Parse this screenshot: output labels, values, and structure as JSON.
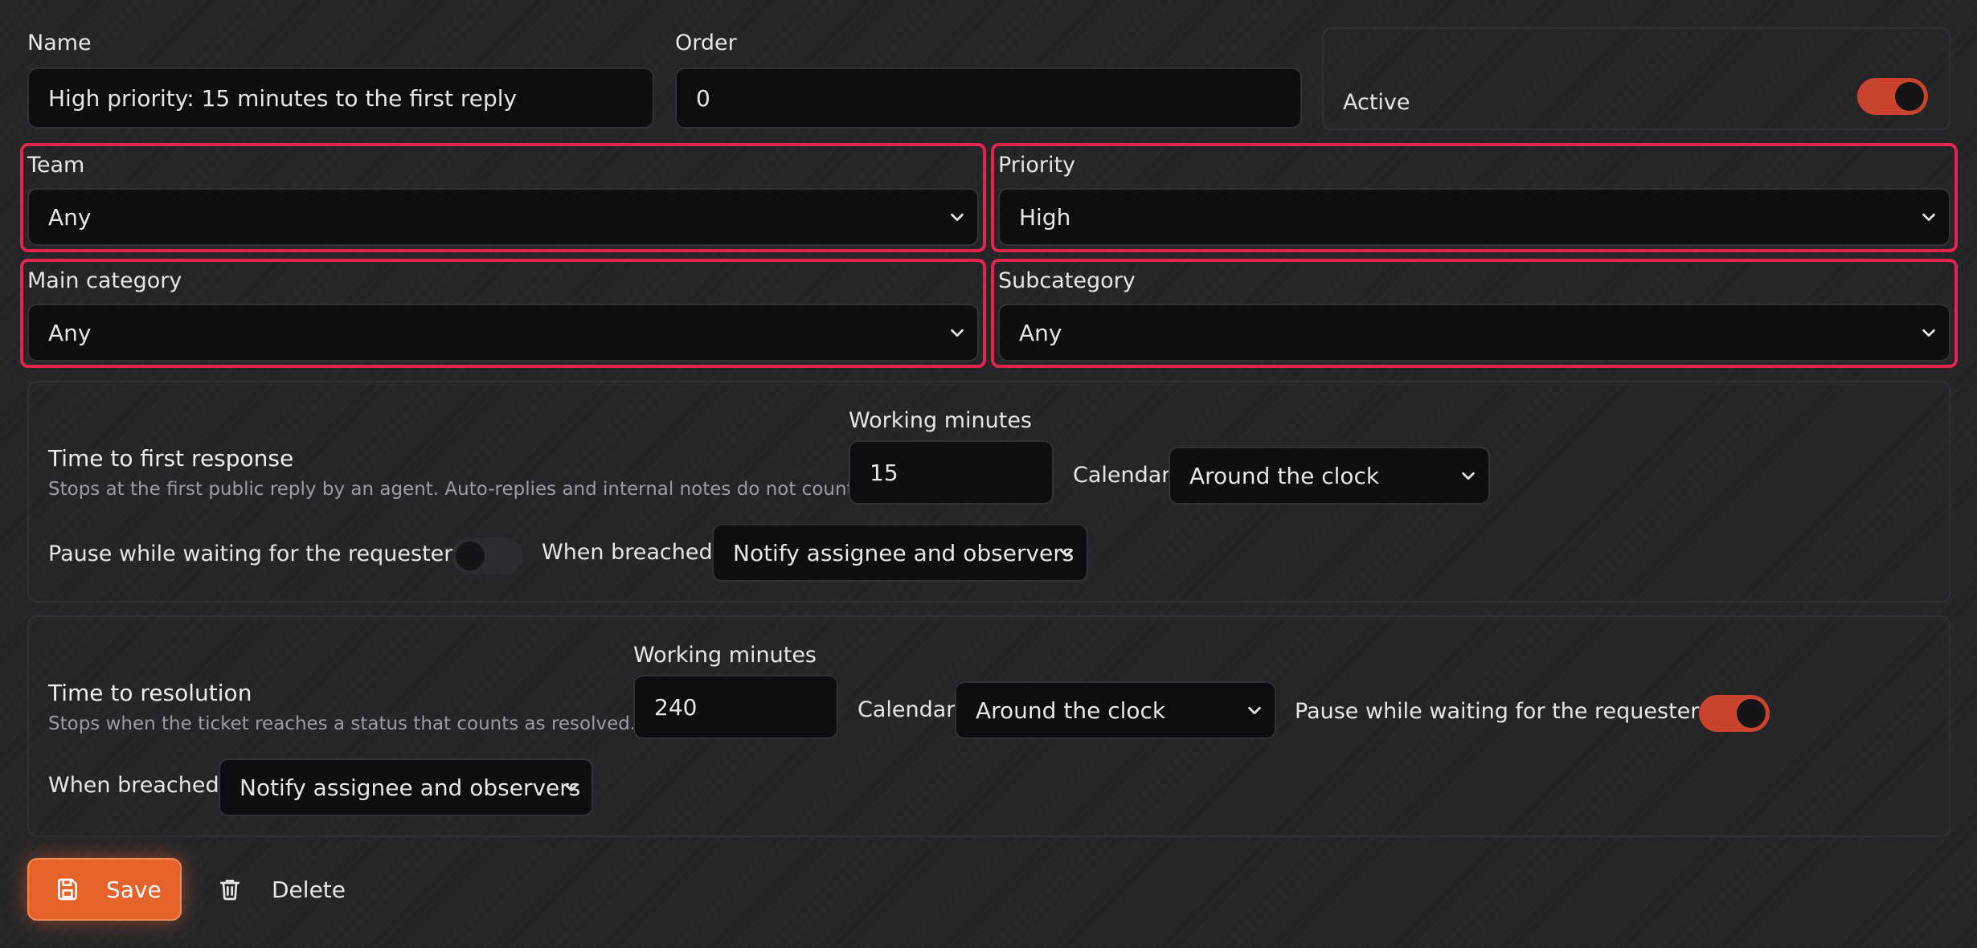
{
  "form": {
    "name": {
      "label": "Name",
      "value": "High priority: 15 minutes to the first reply"
    },
    "order": {
      "label": "Order",
      "value": "0"
    },
    "active": {
      "label": "Active",
      "on": true
    },
    "team": {
      "label": "Team",
      "value": "Any"
    },
    "priority": {
      "label": "Priority",
      "value": "High"
    },
    "main_category": {
      "label": "Main category",
      "value": "Any"
    },
    "subcategory": {
      "label": "Subcategory",
      "value": "Any"
    }
  },
  "first_response": {
    "title": "Time to first response",
    "description": "Stops at the first public reply by an agent. Auto-replies and internal notes do not count.",
    "working_minutes_label": "Working minutes",
    "working_minutes": "15",
    "calendar_label": "Calendar",
    "calendar_value": "Around the clock",
    "pause_label": "Pause while waiting for the requester",
    "pause_on": false,
    "breached_label": "When breached",
    "breached_value": "Notify assignee and observers"
  },
  "resolution": {
    "title": "Time to resolution",
    "description": "Stops when the ticket reaches a status that counts as resolved.",
    "working_minutes_label": "Working minutes",
    "working_minutes": "240",
    "calendar_label": "Calendar",
    "calendar_value": "Around the clock",
    "pause_label": "Pause while waiting for the requester",
    "pause_on": true,
    "breached_label": "When breached",
    "breached_value": "Notify assignee and observers"
  },
  "actions": {
    "save_label": "Save",
    "delete_label": "Delete"
  },
  "colors": {
    "accent": "#e5622a",
    "highlight": "#e0254e",
    "toggle_on": "#c9432e",
    "field_bg": "#0e0e10"
  },
  "icons": {
    "save": "floppy-disk-icon",
    "delete": "trash-icon",
    "select_caret": "chevron-down-icon"
  }
}
